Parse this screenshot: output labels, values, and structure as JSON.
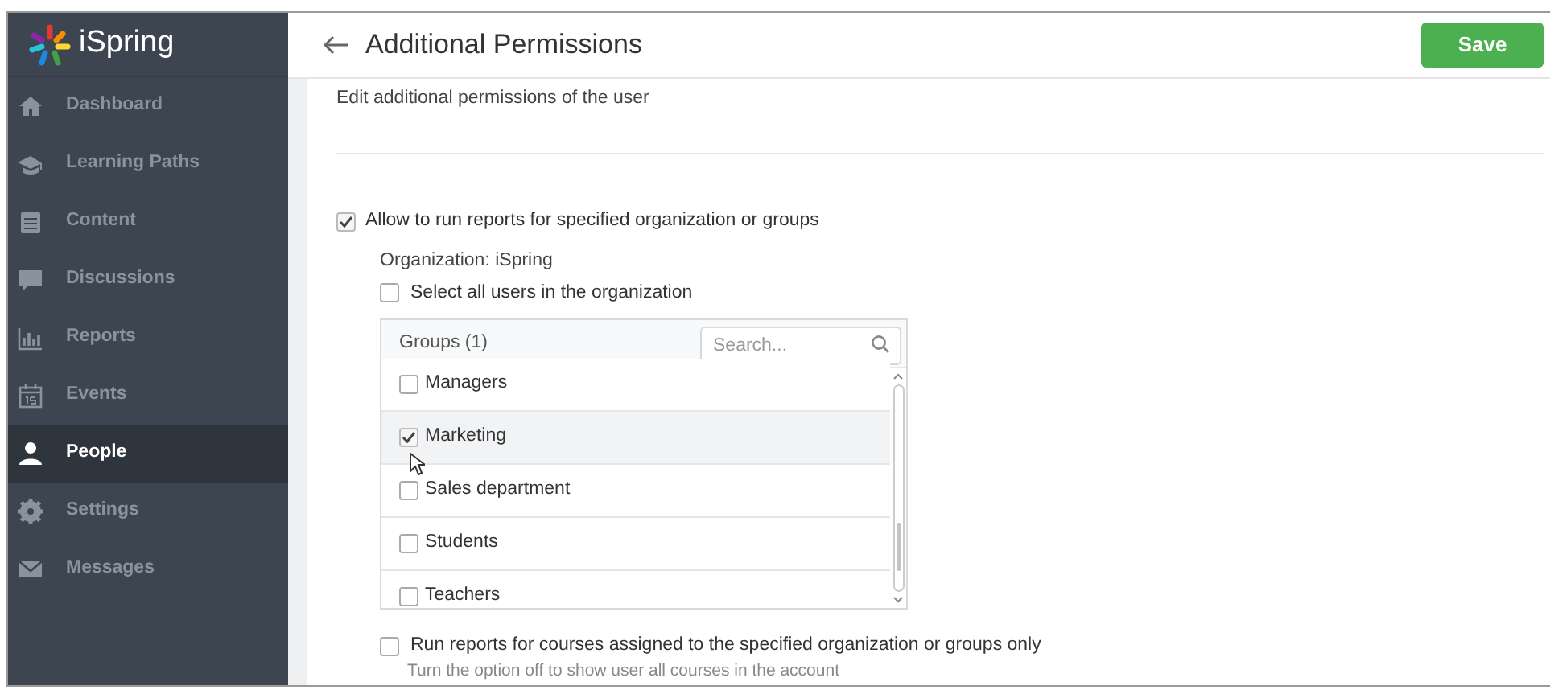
{
  "sidebar": {
    "logo": "iSpring",
    "items": [
      {
        "label": "Dashboard",
        "selected": false
      },
      {
        "label": "Learning Paths",
        "selected": false
      },
      {
        "label": "Content",
        "selected": false
      },
      {
        "label": "Discussions",
        "selected": false
      },
      {
        "label": "Reports",
        "selected": false
      },
      {
        "label": "Events",
        "selected": false
      },
      {
        "label": "People",
        "selected": true
      },
      {
        "label": "Settings",
        "selected": false
      },
      {
        "label": "Messages",
        "selected": false
      }
    ]
  },
  "header": {
    "title": "Additional Permissions",
    "save": "Save"
  },
  "description": "Edit additional permissions of the user",
  "allow_reports": {
    "label": "Allow to run reports for specified organization or groups",
    "checked": true
  },
  "organization": "Organization: iSpring",
  "select_all": {
    "label": "Select all users in the organization",
    "checked": false
  },
  "groups": {
    "title": "Groups (1)",
    "search": {
      "placeholder": "Search..."
    },
    "items": [
      {
        "label": "Managers",
        "checked": false,
        "selected": false
      },
      {
        "label": "Marketing",
        "checked": true,
        "selected": true
      },
      {
        "label": "Sales department",
        "checked": false,
        "selected": false
      },
      {
        "label": "Students",
        "checked": false,
        "selected": false
      },
      {
        "label": "Teachers",
        "checked": false,
        "selected": false
      }
    ]
  },
  "run_reports": {
    "label": "Run reports for courses assigned to the specified organization or groups only",
    "hint": "Turn the option off to show user all courses in the account",
    "checked": false
  }
}
